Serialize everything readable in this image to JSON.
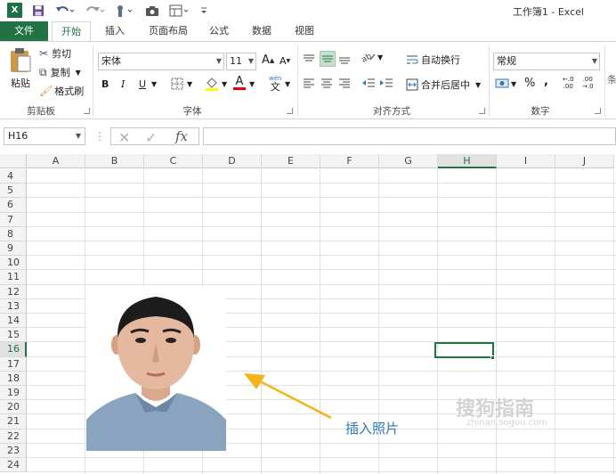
{
  "window": {
    "title": "工作簿1 - Excel"
  },
  "qat": {
    "logo": "X"
  },
  "tabs": [
    {
      "label": "文件"
    },
    {
      "label": "开始"
    },
    {
      "label": "插入"
    },
    {
      "label": "页面布局"
    },
    {
      "label": "公式"
    },
    {
      "label": "数据"
    },
    {
      "label": "视图"
    }
  ],
  "ribbon": {
    "clipboard": {
      "paste": "粘贴",
      "cut": "剪切",
      "copy": "复制",
      "format_painter": "格式刷",
      "group": "剪贴板"
    },
    "font": {
      "name": "宋体",
      "size": "11",
      "bold": "B",
      "italic": "I",
      "underline": "U",
      "grow": "A",
      "shrink": "A",
      "color_a": "A",
      "wen": "wén",
      "wen_char": "文",
      "group": "字体"
    },
    "alignment": {
      "wrap": "自动换行",
      "merge": "合并后居中",
      "group": "对齐方式"
    },
    "number": {
      "format": "常规",
      "percent": "%",
      "comma": ",",
      "inc": ".0→.00",
      "dec": ".00→.0",
      "group": "数字"
    },
    "styles": {
      "partial": "条"
    }
  },
  "formula_bar": {
    "name_box": "H16",
    "fx": "fx",
    "value": ""
  },
  "grid": {
    "columns": [
      "A",
      "B",
      "C",
      "D",
      "E",
      "F",
      "G",
      "H",
      "I",
      "J"
    ],
    "selected_column": "H",
    "rows": [
      "4",
      "5",
      "6",
      "7",
      "8",
      "9",
      "10",
      "11",
      "12",
      "13",
      "14",
      "15",
      "16",
      "17",
      "18",
      "19",
      "20",
      "21",
      "22",
      "23",
      "24"
    ],
    "selected_row": "16",
    "active_cell": "H16"
  },
  "annotation": {
    "text": "插入照片"
  },
  "watermark": {
    "text": "搜狗指南",
    "sub": "zhinan.sogou.com"
  },
  "colors": {
    "accent": "#217346",
    "annotation": "#2f78b6",
    "arrow": "#f5b31b"
  }
}
